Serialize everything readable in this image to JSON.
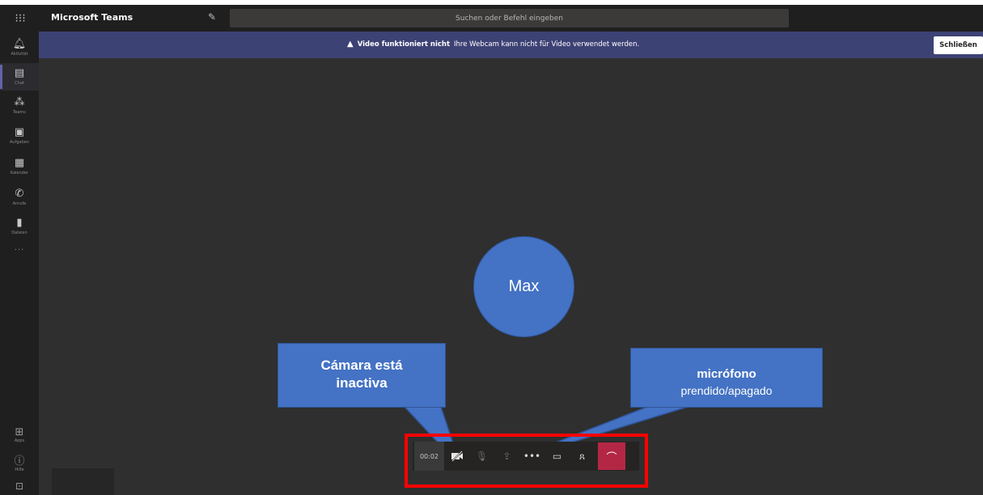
{
  "app": {
    "title": "Microsoft Teams"
  },
  "search": {
    "placeholder": "Suchen oder Befehl eingeben"
  },
  "rail": {
    "items": [
      {
        "label": "Aktivität",
        "icon": "bell-icon"
      },
      {
        "label": "Chat",
        "icon": "chat-icon"
      },
      {
        "label": "Teams",
        "icon": "teams-icon"
      },
      {
        "label": "Aufgaben",
        "icon": "tasks-icon"
      },
      {
        "label": "Kalender",
        "icon": "calendar-icon"
      },
      {
        "label": "Anrufe",
        "icon": "phone-icon"
      },
      {
        "label": "Dateien",
        "icon": "file-icon"
      }
    ],
    "more": "···",
    "apps_label": "Apps",
    "help_label": "Hilfe"
  },
  "banner": {
    "title": "Video funktioniert nicht",
    "message": "Ihre Webcam kann nicht für Video verwendet werden.",
    "close_label": "Schließen"
  },
  "stage": {
    "participant_name": "Max"
  },
  "callouts": {
    "camera_line1": "Cámara está",
    "camera_line2": "inactiva",
    "mic_title": "micrófono",
    "mic_subtitle": "prendido/apagado"
  },
  "controls": {
    "timer": "00:02",
    "buttons": [
      "camera-off-icon",
      "mic-icon",
      "share-screen-icon",
      "more-icon",
      "chat-icon",
      "participants-icon",
      "hang-up-icon"
    ]
  },
  "colors": {
    "accent": "#6264a7",
    "banner_bg": "#3d4275",
    "callout_blue": "#4472c4",
    "hangup_red": "#b32745",
    "highlight_red": "#ff0000"
  }
}
